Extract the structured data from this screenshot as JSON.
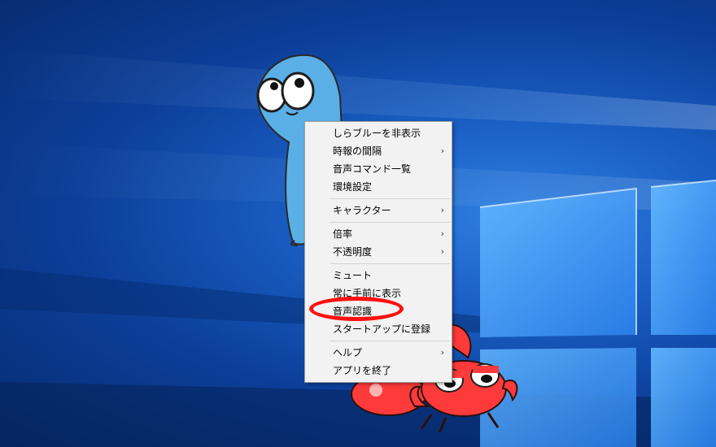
{
  "desktop": {
    "wallpaper": "windows-10-hero",
    "accent": "#1a5fc4"
  },
  "characters": {
    "blue_fish": "shirabulu-character",
    "red_crab": "crab-character"
  },
  "menu": {
    "items": [
      {
        "label": "しらブルーを非表示",
        "submenu": false
      },
      {
        "label": "時報の間隔",
        "submenu": true
      },
      {
        "label": "音声コマンド一覧",
        "submenu": false
      },
      {
        "label": "環境設定",
        "submenu": false
      },
      {
        "label": "キャラクター",
        "submenu": true
      },
      {
        "label": "倍率",
        "submenu": true
      },
      {
        "label": "不透明度",
        "submenu": true
      },
      {
        "label": "ミュート",
        "submenu": false
      },
      {
        "label": "常に手前に表示",
        "submenu": false
      },
      {
        "label": "音声認識",
        "submenu": false
      },
      {
        "label": "スタートアップに登録",
        "submenu": false
      },
      {
        "label": "ヘルプ",
        "submenu": true
      },
      {
        "label": "アプリを終了",
        "submenu": false
      }
    ],
    "submenu_arrow": "›"
  },
  "annotation": {
    "color": "#ff1010",
    "target": "音声認識"
  }
}
